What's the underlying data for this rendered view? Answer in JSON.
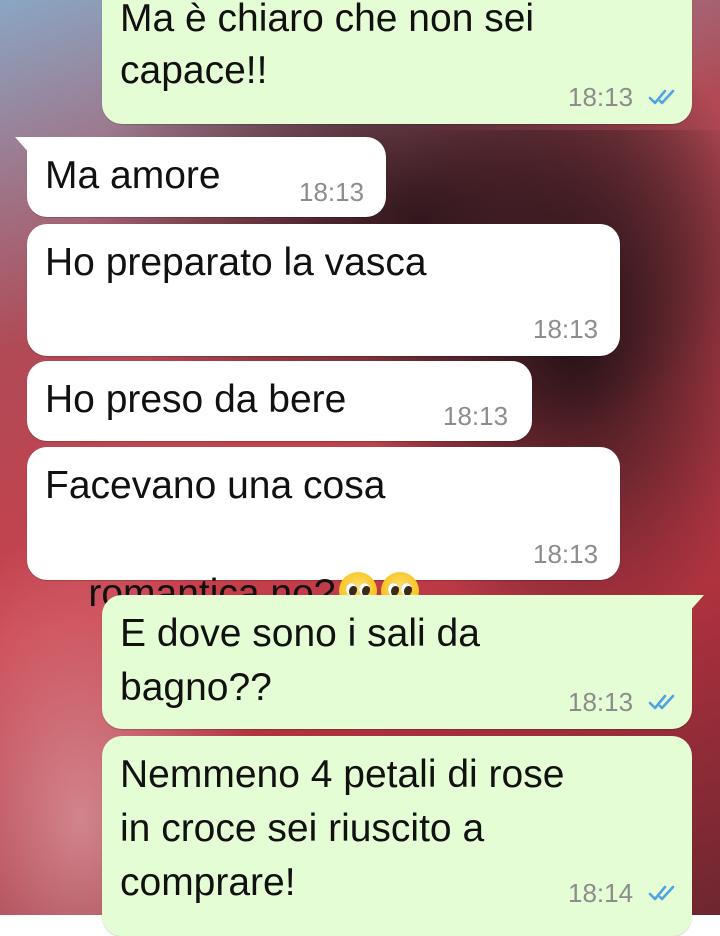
{
  "chat": {
    "messages": [
      {
        "direction": "outgoing",
        "lines": [
          "Ma è chiaro che non sei",
          "capace!!"
        ],
        "time": "18:13",
        "status": "read-double-check-icon"
      },
      {
        "direction": "incoming",
        "lines": [
          "Ma amore"
        ],
        "time": "18:13"
      },
      {
        "direction": "incoming",
        "lines": [
          "Ho preparato la vasca"
        ],
        "time": "18:13"
      },
      {
        "direction": "incoming",
        "lines": [
          "Ho preso da bere"
        ],
        "time": "18:13"
      },
      {
        "direction": "incoming",
        "lines": [
          "Facevano una cosa",
          "romantica no?"
        ],
        "emoji": [
          "pleading-face-emoji",
          "pleading-face-emoji"
        ],
        "time": "18:13"
      },
      {
        "direction": "outgoing",
        "lines": [
          "E dove sono i sali da",
          "bagno??"
        ],
        "time": "18:13",
        "status": "read-double-check-icon"
      },
      {
        "direction": "outgoing",
        "lines": [
          "Nemmeno 4 petali di rose",
          "in croce sei riuscito a",
          "comprare!"
        ],
        "time": "18:14",
        "status": "read-double-check-icon"
      }
    ]
  },
  "colors": {
    "incoming_bubble": "#ffffff",
    "outgoing_bubble": "#e5fdd4",
    "read_ticks": "#4fa3e0",
    "timestamp": "#8c8c8c"
  }
}
